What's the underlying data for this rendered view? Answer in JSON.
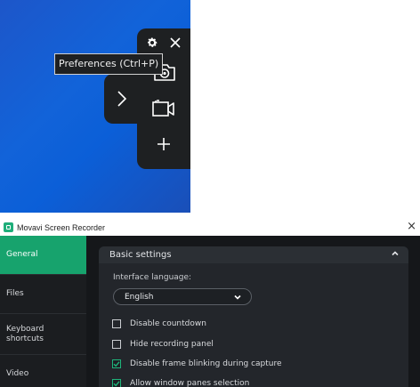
{
  "toolbar": {
    "tooltip": "Preferences (Ctrl+P)",
    "icons": [
      "gear-icon",
      "close-icon",
      "camera-icon",
      "video-camera-icon",
      "plus-icon",
      "chevron-right-icon"
    ]
  },
  "window": {
    "title": "Movavi Screen Recorder",
    "close_glyph": "×"
  },
  "sidebar": {
    "items": [
      {
        "label": "General",
        "active": true
      },
      {
        "label": "Files",
        "active": false
      },
      {
        "label": "Keyboard shortcuts",
        "active": false
      },
      {
        "label": "Video",
        "active": false
      }
    ]
  },
  "basic_settings": {
    "header": "Basic settings",
    "language_label": "Interface language:",
    "language_value": "English",
    "options": [
      {
        "label": "Disable countdown",
        "checked": false
      },
      {
        "label": "Hide recording panel",
        "checked": false
      },
      {
        "label": "Disable frame blinking during capture",
        "checked": true
      },
      {
        "label": "Allow window panes selection",
        "checked": true
      }
    ]
  },
  "colors": {
    "accent": "#17a36d",
    "panel": "#1e2022",
    "window_bg": "#151719"
  }
}
